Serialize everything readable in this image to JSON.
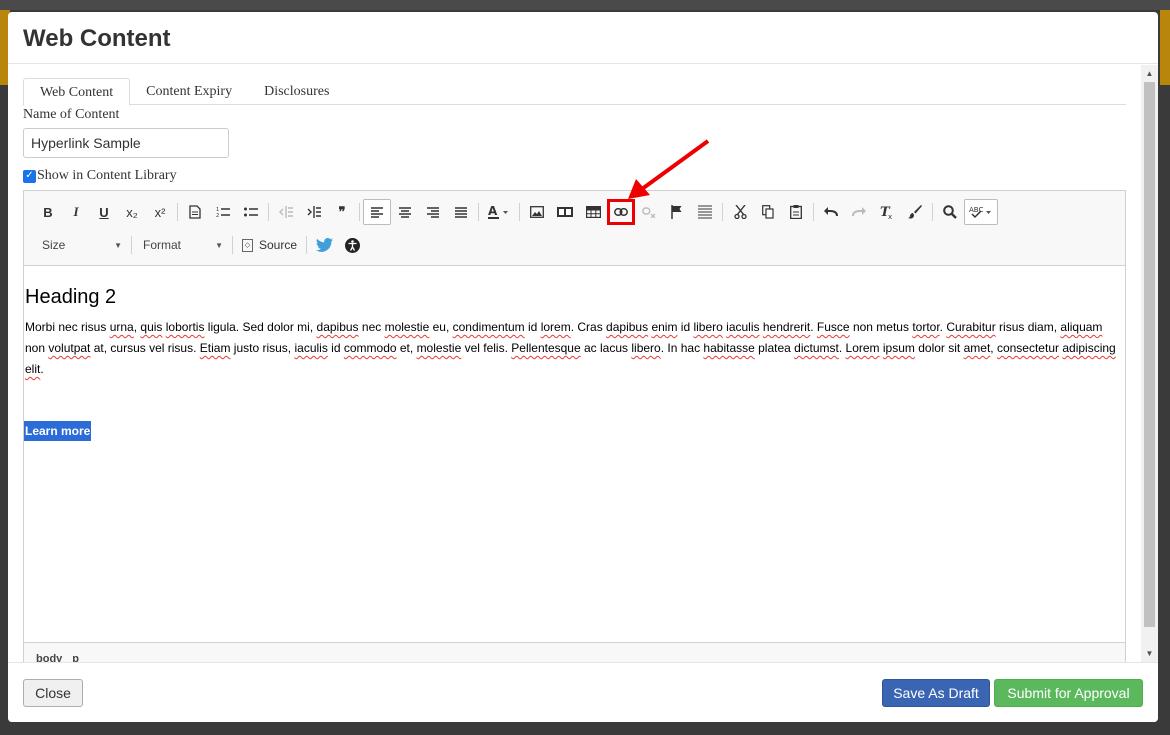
{
  "modal": {
    "title": "Web Content"
  },
  "tabs": [
    {
      "label": "Web Content"
    },
    {
      "label": "Content Expiry"
    },
    {
      "label": "Disclosures"
    }
  ],
  "form": {
    "name_label": "Name of Content",
    "name_value": "Hyperlink Sample",
    "show_library_label": "Show in Content Library"
  },
  "toolbar": {
    "bold": "B",
    "italic": "I",
    "underline": "U",
    "subscript": "x₂",
    "superscript": "x²",
    "blockquote": "❞",
    "size_label": "Size",
    "format_label": "Format",
    "source_label": "Source"
  },
  "editor": {
    "heading": "Heading 2",
    "link_text": "Learn more",
    "status_body": "body",
    "status_p": "p"
  },
  "footer": {
    "close": "Close",
    "save_draft": "Save As Draft",
    "submit": "Submit for Approval"
  },
  "colors": {
    "draft": "#3a65b3",
    "submit": "#5cb85c",
    "highlight": "#e00000",
    "link_bg": "#2b6cd9"
  }
}
